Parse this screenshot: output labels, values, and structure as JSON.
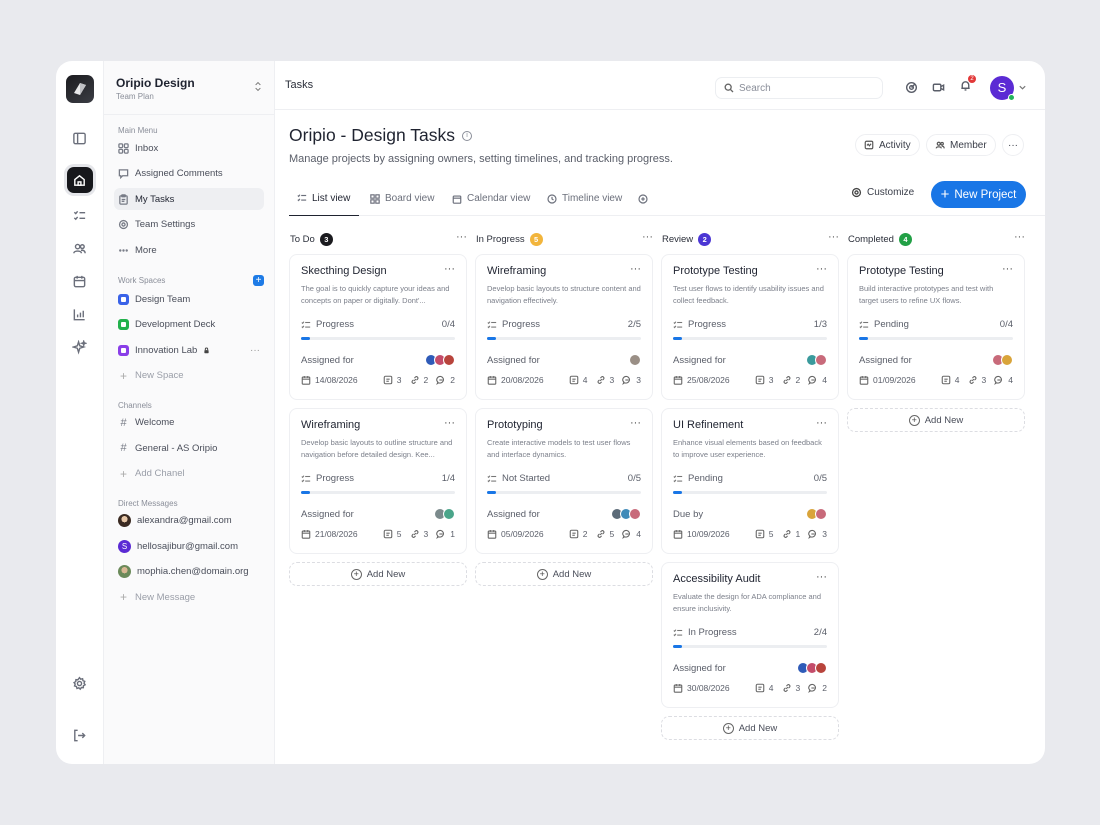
{
  "workspace": {
    "name": "Oripio Design",
    "plan": "Team Plan"
  },
  "sidebar": {
    "main_menu_label": "Main Menu",
    "main_menu": [
      {
        "label": "Inbox",
        "icon": "grid-icon"
      },
      {
        "label": "Assigned Comments",
        "icon": "comment-icon"
      },
      {
        "label": "My Tasks",
        "icon": "clipboard-icon"
      },
      {
        "label": "Team Settings",
        "icon": "gear-icon"
      },
      {
        "label": "More",
        "icon": "more-icon"
      }
    ],
    "workspaces_label": "Work Spaces",
    "workspaces": [
      {
        "label": "Design Team",
        "color": "#3a63e8"
      },
      {
        "label": "Development Deck",
        "color": "#22b14c"
      },
      {
        "label": "Innovation Lab",
        "color": "#8a3ee8"
      }
    ],
    "new_space": "New Space",
    "channels_label": "Channels",
    "channels": [
      "Welcome",
      "General - AS Oripio"
    ],
    "add_channel": "Add Chanel",
    "dm_label": "Direct Messages",
    "dms": [
      "alexandra@gmail.com",
      "hellosajibur@gmail.com",
      "mophia.chen@domain.org"
    ],
    "dm_avatar_letter": "S",
    "new_message": "New Message"
  },
  "topbar": {
    "crumb": "Tasks",
    "search_placeholder": "Search",
    "notif_count": "2",
    "user_initial": "S"
  },
  "page": {
    "title": "Oripio - Design Tasks",
    "info_glyph": "i",
    "description": "Manage projects by assigning owners, setting timelines, and tracking progress.",
    "activity": "Activity",
    "member": "Member",
    "more": "···"
  },
  "tabs": [
    "List view",
    "Board view",
    "Calendar view",
    "Timeline view"
  ],
  "customize": "Customize",
  "new_project": "New Project",
  "add_new": "Add New",
  "columns": [
    {
      "title": "To Do",
      "count": "3",
      "color": "#1b1b1f",
      "cards": [
        {
          "title": "Skecthing Design",
          "desc": "The goal is  to quickly capture your ideas and concepts on paper or digitally. Dont'...",
          "status": "Progress",
          "progress": "0/4",
          "fill": 0.06,
          "assign_label": "Assigned for",
          "date": "14/08/2026",
          "files": "3",
          "links": "2",
          "comments": "2",
          "avatars": [
            "#2f5bb8",
            "#c44c6a",
            "#b8443c"
          ]
        },
        {
          "title": "Wireframing",
          "desc": "Develop basic layouts to outline structure and navigation before detailed design. Kee...",
          "status": "Progress",
          "progress": "1/4",
          "fill": 0.06,
          "assign_label": "Assigned for",
          "date": "21/08/2026",
          "files": "5",
          "links": "3",
          "comments": "1",
          "avatars": [
            "#7b8a8c",
            "#4aa58a"
          ]
        }
      ]
    },
    {
      "title": "In Progress",
      "count": "5",
      "color": "#f2b53c",
      "cards": [
        {
          "title": "Wireframing",
          "desc": "Develop basic layouts to structure content and navigation effectively.",
          "status": "Progress",
          "progress": "2/5",
          "fill": 0.06,
          "assign_label": "Assigned for",
          "date": "20/08/2026",
          "files": "4",
          "links": "3",
          "comments": "3",
          "avatars": [
            "#9a8f86"
          ]
        },
        {
          "title": "Prototyping",
          "desc": "Create interactive models to test user flows and interface dynamics.",
          "status": "Not Started",
          "progress": "0/5",
          "fill": 0.06,
          "assign_label": "Assigned for",
          "date": "05/09/2026",
          "files": "2",
          "links": "5",
          "comments": "4",
          "avatars": [
            "#5c6b78",
            "#3f8ab8",
            "#c86a7a"
          ]
        }
      ]
    },
    {
      "title": "Review",
      "count": "2",
      "color": "#4b36d4",
      "cards": [
        {
          "title": "Prototype Testing",
          "desc": "Test user flows to identify usability issues and collect feedback.",
          "status": "Progress",
          "progress": "1/3",
          "fill": 0.06,
          "assign_label": "Assigned for",
          "date": "25/08/2026",
          "files": "3",
          "links": "2",
          "comments": "4",
          "avatars": [
            "#3a9a9c",
            "#c86a7a"
          ]
        },
        {
          "title": "UI Refinement",
          "desc": "Enhance visual elements based on feedback to improve user experience.",
          "status": "Pending",
          "progress": "0/5",
          "fill": 0.06,
          "assign_label": "Due by",
          "date": "10/09/2026",
          "files": "5",
          "links": "1",
          "comments": "3",
          "avatars": [
            "#d9a43a",
            "#c86a7a"
          ]
        },
        {
          "title": "Accessibility Audit",
          "desc": "Evaluate the design for ADA compliance and ensure inclusivity.",
          "status": "In Progress",
          "progress": "2/4",
          "fill": 0.06,
          "assign_label": "Assigned for",
          "date": "30/08/2026",
          "files": "4",
          "links": "3",
          "comments": "2",
          "avatars": [
            "#2f5bb8",
            "#c44c6a",
            "#b8443c"
          ]
        }
      ]
    },
    {
      "title": "Completed",
      "count": "4",
      "color": "#22a046",
      "cards": [
        {
          "title": "Prototype Testing",
          "desc": "Build interactive prototypes and test with target users to refine UX flows.",
          "status": "Pending",
          "progress": "0/4",
          "fill": 0.06,
          "assign_label": "Assigned for",
          "date": "01/09/2026",
          "files": "4",
          "links": "3",
          "comments": "4",
          "avatars": [
            "#c86a7a",
            "#d9a43a"
          ]
        }
      ]
    }
  ]
}
